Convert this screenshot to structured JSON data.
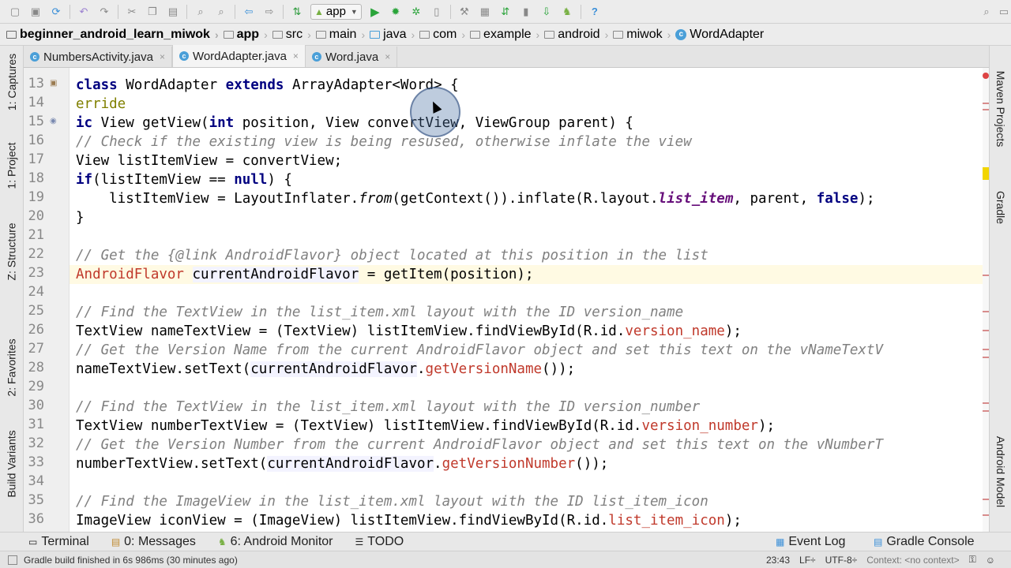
{
  "toolbar": {
    "run_config": "app",
    "icons": [
      "save-all-icon",
      "sync-icon",
      "undo-icon",
      "redo-icon",
      "cut-icon",
      "copy-icon",
      "paste-icon",
      "find-icon",
      "replace-icon",
      "back-icon",
      "forward-icon",
      "make-icon",
      "run-icon",
      "debug-icon",
      "attach-debugger-icon",
      "sdk-manager-icon",
      "avd-manager-icon",
      "sync-gradle-icon",
      "android-device-icon",
      "help-icon",
      "search-everywhere-icon"
    ]
  },
  "breadcrumb": {
    "items": [
      "beginner_android_learn_miwok",
      "app",
      "src",
      "main",
      "java",
      "com",
      "example",
      "android",
      "miwok",
      "WordAdapter"
    ]
  },
  "tabs": [
    {
      "label": "NumbersActivity.java",
      "active": false
    },
    {
      "label": "WordAdapter.java",
      "active": true
    },
    {
      "label": "Word.java",
      "active": false
    }
  ],
  "left_tools": [
    "1: Captures",
    "1: Project",
    "Z: Structure",
    "2: Favorites",
    "Build Variants"
  ],
  "right_tools": [
    "Maven Projects",
    "Gradle",
    "Android Model"
  ],
  "line_numbers": [
    "13",
    "14",
    "15",
    "16",
    "17",
    "18",
    "19",
    "20",
    "21",
    "22",
    "23",
    "24",
    "25",
    "26",
    "27",
    "28",
    "29",
    "30",
    "31",
    "32",
    "33",
    "34",
    "35",
    "36"
  ],
  "bottom_tabs": {
    "terminal": "Terminal",
    "messages": "0: Messages",
    "android_monitor": "6: Android Monitor",
    "todo": "TODO",
    "event_log": "Event Log",
    "gradle_console": "Gradle Console"
  },
  "status": {
    "message": "Gradle build finished in 6s 986ms (30 minutes ago)",
    "position": "23:43",
    "line_sep": "LF÷",
    "encoding": "UTF-8÷",
    "context": "Context: <no context>"
  },
  "colors": {
    "keyword": "#000080",
    "comment": "#808080",
    "field": "#660e7a",
    "current_line": "#fffae3",
    "android_green": "#78b043"
  }
}
